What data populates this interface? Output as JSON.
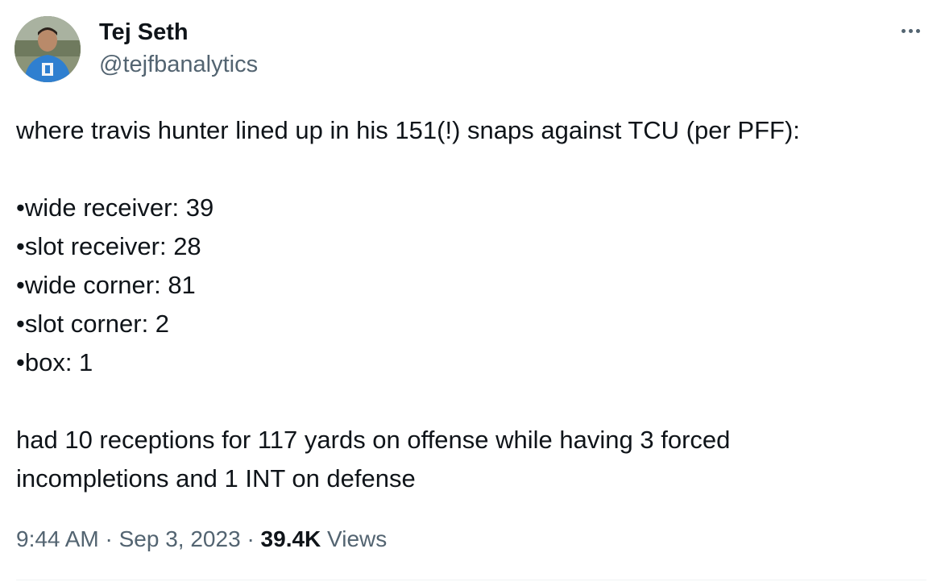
{
  "author": {
    "name": "Tej Seth",
    "handle": "@tejfbanalytics"
  },
  "tweet": {
    "intro": "where travis hunter lined up in his 151(!) snaps against TCU (per PFF):",
    "items": [
      "•wide receiver: 39",
      "•slot receiver: 28",
      "•wide corner: 81",
      "•slot corner: 2",
      "•box: 1"
    ],
    "outro_line1": "had 10 receptions for 117 yards on offense while having 3 forced",
    "outro_line2": "incompletions and 1 INT on defense"
  },
  "meta": {
    "time": "9:44 AM",
    "separator": "·",
    "date": "Sep 3, 2023",
    "views_count": "39.4K",
    "views_label": "Views"
  },
  "icons": {
    "more": "more-horizontal-icon",
    "avatar": "profile-photo"
  },
  "colors": {
    "text_primary": "#0f1419",
    "text_secondary": "#536471",
    "divider": "#eff3f4"
  }
}
